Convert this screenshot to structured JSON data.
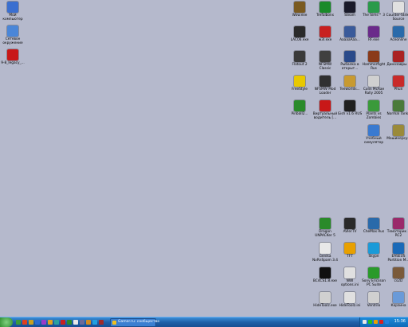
{
  "desktop": {
    "left_icons": [
      {
        "label": "Мой компьютер",
        "icon": "my-computer-icon",
        "color": "#3a6fd0"
      },
      {
        "label": "Сетевое окружение",
        "icon": "network-icon",
        "color": "#4a86d8"
      },
      {
        "label": "9-8_legacy_...",
        "icon": "ati-installer-icon",
        "color": "#c81818"
      }
    ],
    "right_icons": [
      {
        "label": "Wow.exe",
        "icon": "wow-icon",
        "color": "#7a5a20"
      },
      {
        "label": "Trefalbons",
        "icon": "trefalbons-icon",
        "color": "#1a8a2a"
      },
      {
        "label": "Steam",
        "icon": "steam-icon",
        "color": "#1a1a2a"
      },
      {
        "label": "The Sims™ 3",
        "icon": "sims-icon",
        "color": "#2a9a4a"
      },
      {
        "label": "Counter-Strike Source",
        "icon": "cs-source-icon",
        "color": "#e0e0e0"
      },
      {
        "label": "LAC06.exe",
        "icon": "lac06-icon",
        "color": "#2a2a2a"
      },
      {
        "label": "w3l.exe",
        "icon": "w3l-icon",
        "color": "#c82020"
      },
      {
        "label": "АааааАаа...",
        "icon": "game-icon",
        "color": "#3a5a9a"
      },
      {
        "label": "RF.exe",
        "icon": "rf-icon",
        "color": "#6a2a8a"
      },
      {
        "label": "Aceonline",
        "icon": "aceonline-icon",
        "color": "#2a6aaa"
      },
      {
        "label": "Flatout 2",
        "icon": "flatout-icon",
        "color": "#3a3a3a"
      },
      {
        "label": "NFSMW Classic",
        "icon": "nfsmw-icon",
        "color": "#404040"
      },
      {
        "label": "Рыбалка в открыт...",
        "icon": "fishing-icon",
        "color": "#2a4a8a"
      },
      {
        "label": "Hammerfight Rus",
        "icon": "hammerfight-icon",
        "color": "#8a3a1a"
      },
      {
        "label": "Динозавры 2",
        "icon": "dinosaurs-icon",
        "color": "#aa2222"
      },
      {
        "label": "FreeStyle",
        "icon": "freestyle-icon",
        "color": "#e8c800"
      },
      {
        "label": "NFSMW Mod Loader",
        "icon": "nfsmw-loader-icon",
        "color": "#303030"
      },
      {
        "label": "Teeworlds...",
        "icon": "teeworlds-icon",
        "color": "#c89a30"
      },
      {
        "label": "Colin McRae Rally 2005",
        "icon": "colin-mcrae-icon",
        "color": "#d0d0d0"
      },
      {
        "label": "Phun",
        "icon": "phun-icon",
        "color": "#c82a2a"
      },
      {
        "label": "Pinball2...",
        "icon": "pinball-icon",
        "color": "#2a8a2a"
      },
      {
        "label": "Виртуальный водитель [...",
        "icon": "adobe-icon",
        "color": "#c81818"
      },
      {
        "label": "Gish v1.6 RUS",
        "icon": "gish-icon",
        "color": "#202020"
      },
      {
        "label": "Plants vs Zombies",
        "icon": "plants-vs-zombies-icon",
        "color": "#3a9a3a"
      },
      {
        "label": "Normal Tanks",
        "icon": "normal-tanks-icon",
        "color": "#4a7a3a"
      },
      {
        "label": "Учебный симулятор",
        "icon": "simulator-icon",
        "color": "#3a7ad0"
      },
      {
        "label": "Машинерсум",
        "icon": "machine-icon",
        "color": "#9a8a3a"
      }
    ],
    "right_bottom_icons": [
      {
        "label": "Dragon UNPACKer 5",
        "icon": "dragon-unpacker-icon",
        "color": "#2a8a2a"
      },
      {
        "label": "AVIerTV",
        "icon": "aviertv-icon",
        "color": "#2a2a2a"
      },
      {
        "label": "CheMax Rus",
        "icon": "chemax-icon",
        "color": "#2a6aaa"
      },
      {
        "label": "Тематорик 2 RC2",
        "icon": "tematorik-icon",
        "color": "#9a2a6a"
      },
      {
        "label": "Genika NvRnSpam 3.4",
        "icon": "document-icon",
        "color": "#e8e8e8"
      },
      {
        "label": "TFT",
        "icon": "tft-icon",
        "color": "#e8a000"
      },
      {
        "label": "Skype",
        "icon": "skype-icon",
        "color": "#1a9ad8"
      },
      {
        "label": "EASEUS Partition M...",
        "icon": "easeus-icon",
        "color": "#1a6ab8"
      },
      {
        "label": "BC4CS1.8.exe",
        "icon": "bc4cs-icon",
        "color": "#101010"
      },
      {
        "label": "NWI options.ini",
        "icon": "ini-file-icon",
        "color": "#e0e0e0"
      },
      {
        "label": "Sony Ericsson PC Suite",
        "icon": "sony-ericsson-icon",
        "color": "#2a9a2a"
      },
      {
        "label": "cs2D",
        "icon": "cs2d-icon",
        "color": "#7a5a3a"
      },
      {
        "label": "HideToolz.exe",
        "icon": "hidetoolz-icon",
        "color": "#d0d0d0"
      },
      {
        "label": "HideToolz.ini",
        "icon": "ini-file-icon",
        "color": "#e0e0e0"
      },
      {
        "label": "Ventrilo",
        "icon": "ventrilo-icon",
        "color": "#d0d0d0"
      },
      {
        "label": "Корзина",
        "icon": "recycle-bin-icon",
        "color": "#6a9ad8"
      }
    ]
  },
  "taskbar": {
    "quick_launch_colors": [
      "#3a9a3a",
      "#e04020",
      "#c8a020",
      "#2a6ad0",
      "#9a3ac8",
      "#e0a020",
      "#2aa0a0",
      "#c82020",
      "#2a8a2a",
      "#e8e8e8",
      "#6a6a9a",
      "#d08a20",
      "#20a0e0",
      "#a02a2a"
    ],
    "active_task": {
      "label": "Gamer.ru: сообщество",
      "icon": "browser-icon"
    },
    "tray_colors": [
      "#e8e8e8",
      "#20c020",
      "#e8a000",
      "#d82020",
      "#2080e0"
    ],
    "clock": "15:36"
  }
}
